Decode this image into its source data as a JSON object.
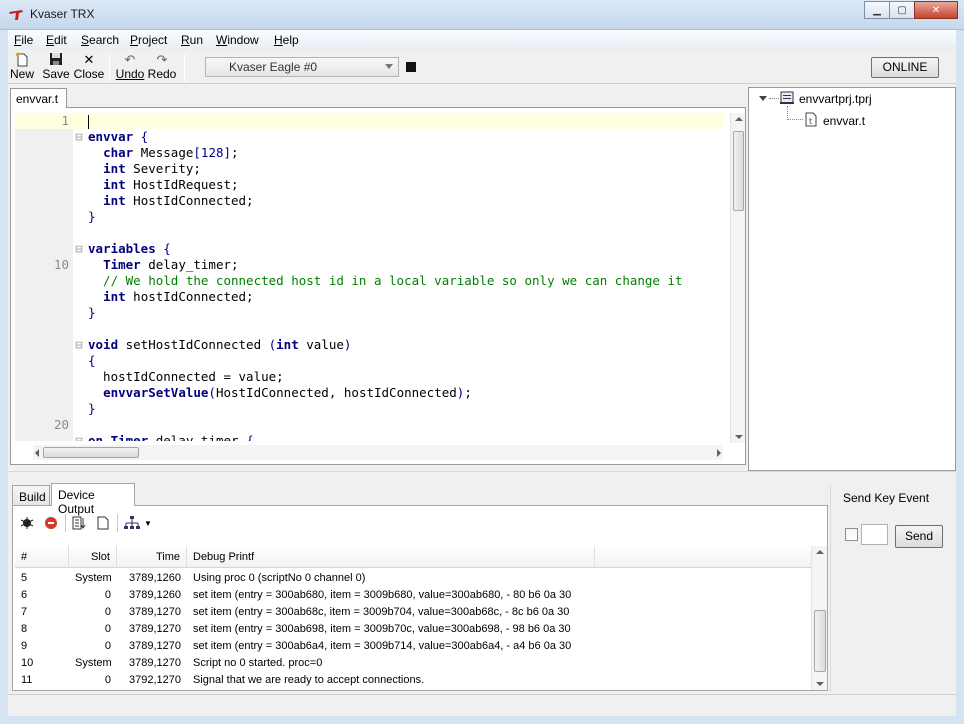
{
  "window": {
    "title": "Kvaser TRX"
  },
  "menu": [
    {
      "label": "File",
      "u": "F",
      "rest": "ile"
    },
    {
      "label": "Edit",
      "u": "E",
      "rest": "dit"
    },
    {
      "label": "Search",
      "u": "S",
      "rest": "earch"
    },
    {
      "label": "Project",
      "u": "P",
      "rest": "roject"
    },
    {
      "label": "Run",
      "u": "R",
      "rest": "un"
    },
    {
      "label": "Window",
      "u": "W",
      "rest": "indow"
    },
    {
      "label": "Help",
      "u": "H",
      "rest": "elp"
    }
  ],
  "toolbar": {
    "new_label": "New",
    "save_label": "Save",
    "close_label": "Close",
    "undo_label": "Undo",
    "redo_label": "Redo",
    "device": "Kvaser Eagle #0",
    "online_label": "ONLINE"
  },
  "editor": {
    "tab": "envvar.t",
    "lines": [
      {
        "num": "1",
        "fold": "",
        "segs": []
      },
      {
        "num": "",
        "fold": "⊟",
        "segs": [
          [
            "kw",
            "envvar"
          ],
          [
            "kw2",
            " {"
          ]
        ]
      },
      {
        "num": "",
        "fold": "",
        "segs": [
          [
            "",
            "  "
          ],
          [
            "kw",
            "char"
          ],
          [
            "",
            " Message"
          ],
          [
            "nm",
            "[128]"
          ],
          [
            "",
            ";"
          ]
        ]
      },
      {
        "num": "",
        "fold": "",
        "segs": [
          [
            "",
            "  "
          ],
          [
            "kw",
            "int"
          ],
          [
            "",
            " Severity;"
          ]
        ]
      },
      {
        "num": "",
        "fold": "",
        "segs": [
          [
            "",
            "  "
          ],
          [
            "kw",
            "int"
          ],
          [
            "",
            " HostIdRequest;"
          ]
        ]
      },
      {
        "num": "",
        "fold": "",
        "segs": [
          [
            "",
            "  "
          ],
          [
            "kw",
            "int"
          ],
          [
            "",
            " HostIdConnected;"
          ]
        ]
      },
      {
        "num": "",
        "fold": "",
        "segs": [
          [
            "kw2",
            "}"
          ]
        ]
      },
      {
        "num": "",
        "fold": "",
        "segs": []
      },
      {
        "num": "",
        "fold": "⊟",
        "segs": [
          [
            "kw",
            "variables"
          ],
          [
            "kw2",
            " {"
          ]
        ]
      },
      {
        "num": "10",
        "fold": "",
        "segs": [
          [
            "",
            "  "
          ],
          [
            "kw",
            "Timer"
          ],
          [
            "",
            " delay_timer;"
          ]
        ]
      },
      {
        "num": "",
        "fold": "",
        "segs": [
          [
            "cm",
            "  // We hold the connected host id in a local variable so only we can change it"
          ]
        ]
      },
      {
        "num": "",
        "fold": "",
        "segs": [
          [
            "",
            "  "
          ],
          [
            "kw",
            "int"
          ],
          [
            "",
            " hostIdConnected;"
          ]
        ]
      },
      {
        "num": "",
        "fold": "",
        "segs": [
          [
            "kw2",
            "}"
          ]
        ]
      },
      {
        "num": "",
        "fold": "",
        "segs": []
      },
      {
        "num": "",
        "fold": "⊟",
        "segs": [
          [
            "kw",
            "void"
          ],
          [
            "",
            " setHostIdConnected "
          ],
          [
            "kw2",
            "("
          ],
          [
            "kw",
            "int"
          ],
          [
            "",
            " value"
          ],
          [
            "kw2",
            ")"
          ]
        ]
      },
      {
        "num": "",
        "fold": "",
        "segs": [
          [
            "kw2",
            "{"
          ]
        ]
      },
      {
        "num": "",
        "fold": "",
        "segs": [
          [
            "",
            "  hostIdConnected = value;"
          ]
        ]
      },
      {
        "num": "",
        "fold": "",
        "segs": [
          [
            "",
            "  "
          ],
          [
            "kw",
            "envvarSetValue"
          ],
          [
            "kw2",
            "("
          ],
          [
            "",
            "HostIdConnected, hostIdConnected"
          ],
          [
            "kw2",
            ")"
          ],
          [
            "",
            ";"
          ]
        ]
      },
      {
        "num": "",
        "fold": "",
        "segs": [
          [
            "kw2",
            "}"
          ]
        ]
      },
      {
        "num": "20",
        "fold": "",
        "segs": []
      },
      {
        "num": "",
        "fold": "⊟",
        "segs": [
          [
            "kw",
            "on"
          ],
          [
            "",
            " "
          ],
          [
            "kw",
            "Timer"
          ],
          [
            "",
            " delay timer "
          ],
          [
            "kw2",
            "{"
          ]
        ]
      }
    ]
  },
  "project": {
    "root": "envvartprj.tprj",
    "file": "envvar.t"
  },
  "bottom": {
    "tabs": [
      "Build",
      "Device Output"
    ],
    "columns": [
      "#",
      "Slot",
      "Time",
      "Debug Printf"
    ],
    "rows": [
      {
        "n": "5",
        "slot": "System",
        "time": "3789,1260",
        "msg": "Using proc 0 (scriptNo 0 channel 0)"
      },
      {
        "n": "6",
        "slot": "0",
        "time": "3789,1260",
        "msg": "set item (entry = 300ab680, item = 3009b680, value=300ab680, - 80 b6 0a 30"
      },
      {
        "n": "7",
        "slot": "0",
        "time": "3789,1270",
        "msg": "set item (entry = 300ab68c, item = 3009b704, value=300ab68c, - 8c b6 0a 30"
      },
      {
        "n": "8",
        "slot": "0",
        "time": "3789,1270",
        "msg": "set item (entry = 300ab698, item = 3009b70c, value=300ab698, - 98 b6 0a 30"
      },
      {
        "n": "9",
        "slot": "0",
        "time": "3789,1270",
        "msg": "set item (entry = 300ab6a4, item = 3009b714, value=300ab6a4, - a4 b6 0a 30"
      },
      {
        "n": "10",
        "slot": "System",
        "time": "3789,1270",
        "msg": "Script no 0 started. proc=0"
      },
      {
        "n": "11",
        "slot": "0",
        "time": "3792,1270",
        "msg": "Signal that we are ready to accept connections."
      }
    ]
  },
  "sendkey": {
    "title": "Send Key Event",
    "send_label": "Send",
    "key_value": ""
  },
  "icons": {
    "app": "kvaser-logo-icon",
    "new": "new-file-icon",
    "save": "floppy-disk-icon",
    "close": "close-x-icon",
    "undo": "undo-arrow-icon",
    "redo": "redo-arrow-icon"
  }
}
